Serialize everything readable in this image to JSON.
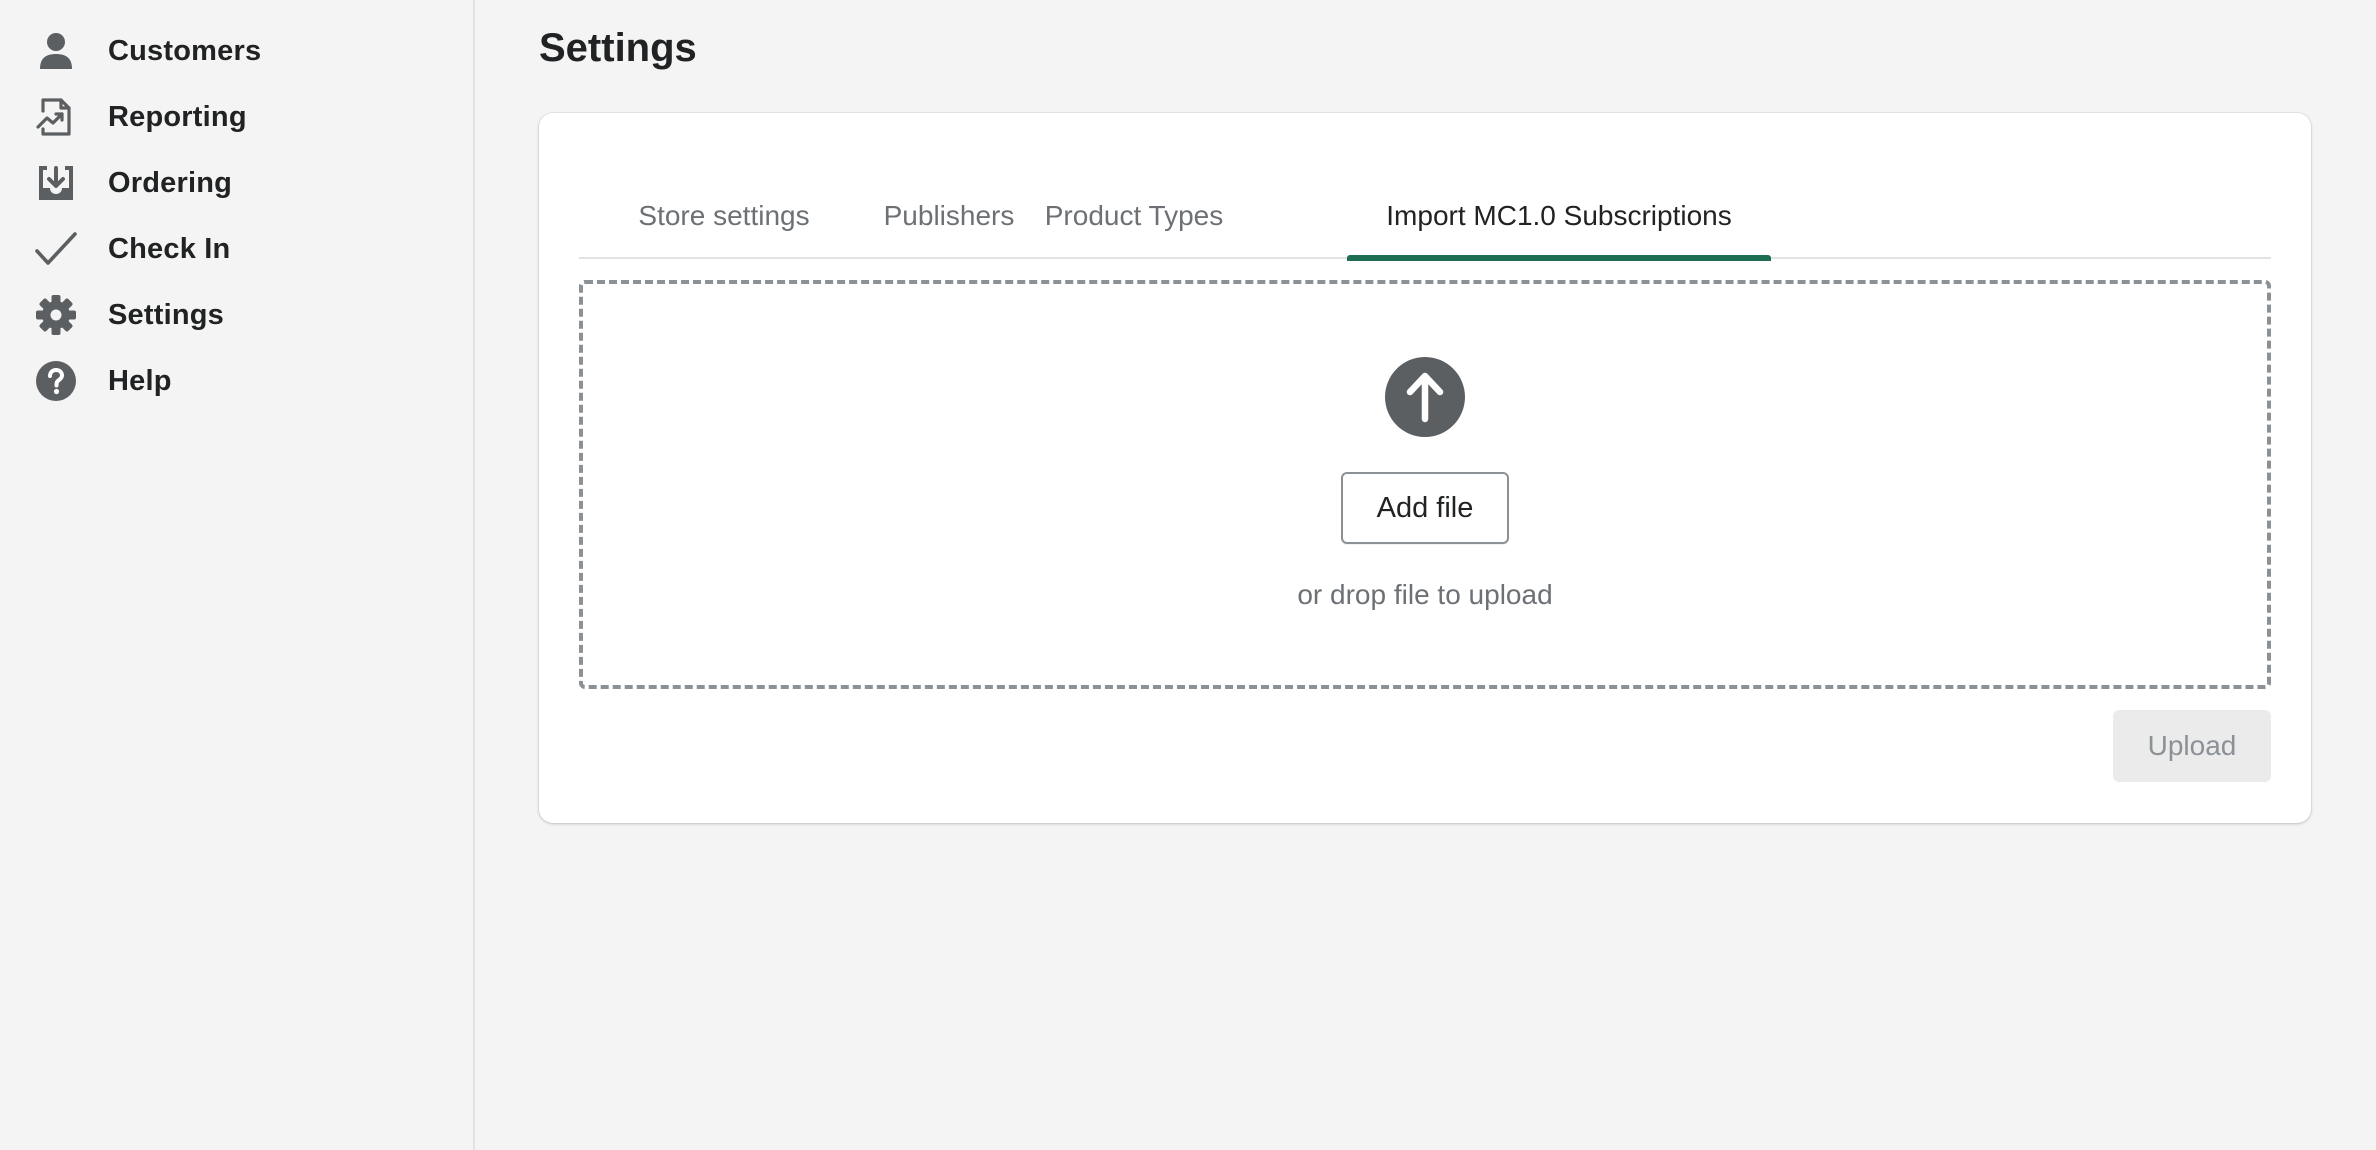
{
  "sidebar": {
    "items": [
      {
        "label": "Customers",
        "icon": "person-icon"
      },
      {
        "label": "Reporting",
        "icon": "report-chart-icon"
      },
      {
        "label": "Ordering",
        "icon": "inbox-download-icon"
      },
      {
        "label": "Check In",
        "icon": "checkmark-icon"
      },
      {
        "label": "Settings",
        "icon": "gear-icon"
      },
      {
        "label": "Help",
        "icon": "question-circle-icon"
      }
    ]
  },
  "page": {
    "title": "Settings"
  },
  "tabs": [
    {
      "label": "Store settings",
      "active": false
    },
    {
      "label": "Publishers",
      "active": false
    },
    {
      "label": "Product Types",
      "active": false
    },
    {
      "label": "Import MC1.0 Subscriptions",
      "active": true
    }
  ],
  "dropzone": {
    "icon": "upload-arrow-icon",
    "add_file_label": "Add file",
    "hint": "or drop file to upload"
  },
  "actions": {
    "upload_label": "Upload"
  },
  "colors": {
    "accent": "#1e6e53",
    "icon": "#5c5f62",
    "background": "#f4f4f4"
  }
}
